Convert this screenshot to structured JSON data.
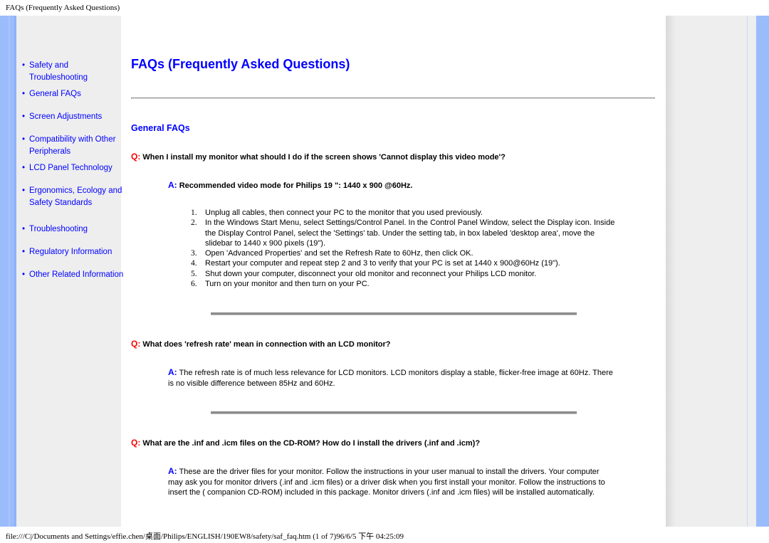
{
  "print_header": "FAQs (Frequently Asked Questions)",
  "print_footer": "file:///C|/Documents and Settings/effie.chen/桌面/Philips/ENGLISH/190EW8/safety/saf_faq.htm (1 of 7)96/6/5 下午 04:25:09",
  "colors": {
    "link_blue": "#0000ff",
    "question_red": "#ff0000",
    "side_strip_blue": "#9bbcfb",
    "sidebar_gray": "#eeeeee"
  },
  "sidebar": {
    "bullet": "•",
    "items": [
      {
        "label": "Safety and Troubleshooting"
      },
      {
        "label": "General FAQs"
      },
      {
        "label": "Screen Adjustments"
      },
      {
        "label": "Compatibility with Other Peripherals"
      },
      {
        "label": "LCD Panel Technology"
      },
      {
        "label": "Ergonomics, Ecology and Safety Standards"
      },
      {
        "label": "Troubleshooting"
      },
      {
        "label": "Regulatory Information"
      },
      {
        "label": "Other Related Information"
      }
    ]
  },
  "main": {
    "title": "FAQs (Frequently Asked Questions)",
    "section_heading": "General FAQs",
    "q_label": "Q:",
    "a_label": "A:",
    "faqs": [
      {
        "question": "When I install my monitor what should I do if the screen shows 'Cannot display this video mode'?",
        "answer": "Recommended video mode for Philips 19 \": 1440 x 900 @60Hz.",
        "steps": [
          {
            "num": "1.",
            "text": "Unplug all cables, then connect your PC to the monitor that you used previously."
          },
          {
            "num": "2.",
            "text": "In the Windows Start Menu, select Settings/Control Panel. In the Control Panel Window, select the Display icon. Inside the Display Control Panel, select the 'Settings' tab. Under the setting tab, in box labeled 'desktop area', move the slidebar to 1440 x 900 pixels (19\")."
          },
          {
            "num": "3.",
            "text": "Open 'Advanced Properties' and set the Refresh Rate to 60Hz, then click OK."
          },
          {
            "num": "4.",
            "text": "Restart your computer and repeat step 2 and 3 to verify that your PC is set at 1440 x 900@60Hz (19\")."
          },
          {
            "num": "5.",
            "text": "Shut down your computer, disconnect your old monitor and reconnect your Philips LCD monitor."
          },
          {
            "num": "6.",
            "text": "Turn on your monitor and then turn on your PC."
          }
        ]
      },
      {
        "question": "What does 'refresh rate' mean in connection with an LCD monitor?",
        "answer": "The refresh rate is of much less relevance for LCD monitors. LCD monitors display a stable, flicker-free image at 60Hz. There is no visible difference between 85Hz and 60Hz."
      },
      {
        "question": "What are the .inf and .icm files on the CD-ROM? How do I install the drivers (.inf and .icm)?",
        "answer": "These are the driver files for your monitor. Follow the instructions in your user manual to install the drivers. Your computer may ask you for monitor drivers (.inf and .icm files) or a driver disk when you first install your monitor. Follow the instructions to insert the ( companion CD-ROM) included in this package. Monitor drivers (.inf and .icm files) will be installed automatically."
      }
    ]
  }
}
